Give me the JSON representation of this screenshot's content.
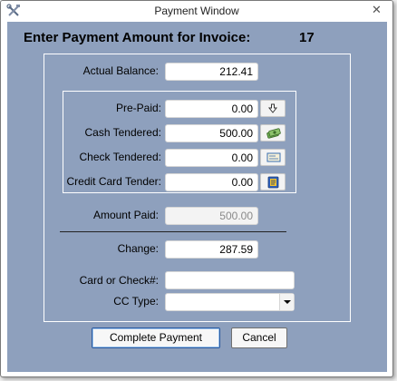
{
  "window": {
    "title": "Payment Window",
    "close_glyph": "✕"
  },
  "header": {
    "title": "Enter Payment Amount for Invoice:",
    "invoice_number": "17"
  },
  "fields": {
    "actual_balance": {
      "label": "Actual Balance:",
      "value": "212.41"
    },
    "pre_paid": {
      "label": "Pre-Paid:",
      "value": "0.00",
      "icon": "down-arrow-icon"
    },
    "cash_tendered": {
      "label": "Cash Tendered:",
      "value": "500.00",
      "icon": "cash-icon"
    },
    "check_tendered": {
      "label": "Check Tendered:",
      "value": "0.00",
      "icon": "check-icon"
    },
    "credit_card_tender": {
      "label": "Credit Card Tender:",
      "value": "0.00",
      "icon": "credit-card-icon"
    },
    "amount_paid": {
      "label": "Amount Paid:",
      "value": "500.00"
    },
    "change": {
      "label": "Change:",
      "value": "287.59"
    },
    "card_or_check": {
      "label": "Card or Check#:",
      "value": ""
    },
    "cc_type": {
      "label": "CC Type:",
      "value": ""
    }
  },
  "buttons": {
    "complete": "Complete Payment",
    "cancel": "Cancel"
  },
  "colors": {
    "client_bg": "#8ea0bd",
    "frame": "#ffffff"
  }
}
